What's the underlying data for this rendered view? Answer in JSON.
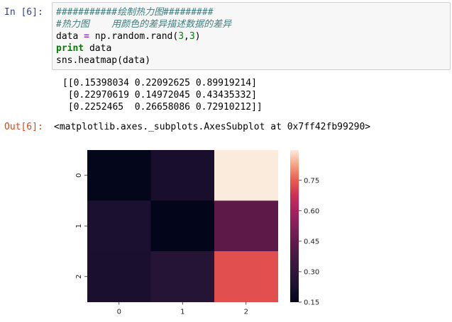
{
  "input_prompt": "In [6]:",
  "output_prompt": "Out[6]:",
  "code": {
    "line1": "###########绘制热力图#########",
    "line2": "#热力图    用颜色的差异描述数据的差异",
    "line3_var": "data",
    "line3_op": "=",
    "line3_call": "np.random.rand(",
    "line3_num1": "3",
    "line3_comma": ",",
    "line3_num2": "3",
    "line3_close": ")",
    "line4_kw": "print",
    "line4_arg": "data",
    "line5": "sns.heatmap(data)"
  },
  "stdout": [
    "[[0.15398034 0.22092625 0.89919214]",
    " [0.22970619 0.14972045 0.43435332]",
    " [0.2252465  0.26658086 0.72910212]]"
  ],
  "output_text": "<matplotlib.axes._subplots.AxesSubplot at 0x7ff42fb99290>",
  "chart_data": {
    "type": "heatmap",
    "rows": [
      "0",
      "1",
      "2"
    ],
    "cols": [
      "0",
      "1",
      "2"
    ],
    "values": [
      [
        0.15398034,
        0.22092625,
        0.89919214
      ],
      [
        0.22970619,
        0.14972045,
        0.43435332
      ],
      [
        0.2252465,
        0.26658086,
        0.72910212
      ]
    ],
    "vmin": 0.14972045,
    "vmax": 0.89919214,
    "colorbar_ticks": [
      "0.15",
      "0.30",
      "0.45",
      "0.60",
      "0.75"
    ],
    "colorbar_tick_values": [
      0.15,
      0.3,
      0.45,
      0.6,
      0.75
    ],
    "colormap": "rocket"
  }
}
